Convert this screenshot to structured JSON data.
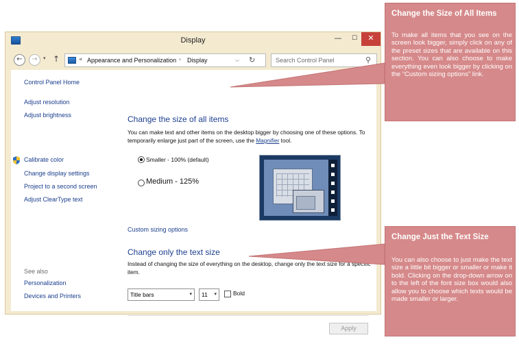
{
  "window": {
    "title": "Display",
    "minimize": "—",
    "maximize": "☐",
    "close": "✕"
  },
  "navbar": {
    "back": "←",
    "forward": "→",
    "recent": "▾",
    "up": "↑",
    "address_sep": "«",
    "crumbs": [
      "Appearance and Personalization",
      "Display"
    ],
    "crumb_arrow": "›",
    "dropdown": "⌵",
    "refresh": "↻",
    "search_placeholder": "Search Control Panel",
    "search_glyph": "⚲"
  },
  "sidebar": {
    "items": [
      "Control Panel Home",
      "Adjust resolution",
      "Adjust brightness",
      "Calibrate color",
      "Change display settings",
      "Project to a second screen",
      "Adjust ClearType text"
    ],
    "see_also_label": "See also",
    "see_also": [
      "Personalization",
      "Devices and Printers"
    ]
  },
  "main": {
    "heading_size": "Change the size of all items",
    "desc_size_before": "You can make text and other items on the desktop bigger by choosing one of these options. To temporarily enlarge just part of the screen, use the ",
    "desc_size_link": "Magnifier",
    "desc_size_after": " tool.",
    "options": [
      {
        "label": "Smaller - 100% (default)",
        "checked": true
      },
      {
        "label": "Medium - 125%",
        "checked": false
      }
    ],
    "custom_sizing": "Custom sizing options",
    "heading_text": "Change only the text size",
    "desc_text": "Instead of changing the size of everything on the desktop, change only the text size for a specific item.",
    "item_select": "Title bars",
    "size_select": "11",
    "select_arrow": "▾",
    "bold_label": "Bold",
    "bold_checked": false,
    "apply": "Apply"
  },
  "callouts": [
    {
      "title": "Change the Size of All Items",
      "body": "To make all items that you see on the screen look bigger, simply click on any of the preset sizes that are available on this section. You can also choose to make everything even look bigger by clicking on the “Custom sizing options” link."
    },
    {
      "title": "Change Just the Text Size",
      "body": "You can also choose to just make the text size a little bit bigger or smaller or make it bold. Clicking on the drop-down arrow on to the left of the font size box would also allow you to choose which texts would be made smaller or larger."
    }
  ],
  "colors": {
    "callout": "#d6898a",
    "link": "#1a3e8c",
    "heading": "#1d3f8f",
    "close_button": "#c7413a"
  }
}
